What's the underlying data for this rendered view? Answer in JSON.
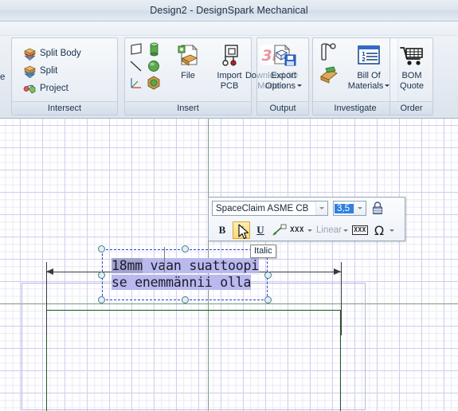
{
  "window": {
    "title": "Design2 - DesignSpark Mechanical"
  },
  "ribbon": {
    "clipped_left_fragment": "e",
    "groups": [
      {
        "name": "Intersect",
        "label": "Intersect",
        "items": [
          {
            "label": "Split Body",
            "icon": "split-body-icon"
          },
          {
            "label": "Split",
            "icon": "split-icon"
          },
          {
            "label": "Project",
            "icon": "project-icon"
          }
        ]
      },
      {
        "name": "Insert",
        "label": "Insert",
        "small_icons": [
          {
            "icon": "plane-icon"
          },
          {
            "icon": "cylinder-icon"
          },
          {
            "icon": "line-icon"
          },
          {
            "icon": "sphere-icon"
          },
          {
            "icon": "axis-system-icon"
          },
          {
            "icon": "cube-icon"
          }
        ],
        "items": [
          {
            "label_line1": "File",
            "label_line2": "",
            "icon": "insert-file-icon",
            "dropdown": false
          },
          {
            "label_line1": "Import",
            "label_line2": "PCB",
            "icon": "import-pcb-icon",
            "dropdown": false
          },
          {
            "label_line1": "Download 3D",
            "label_line2": "Models",
            "icon": "download-3d-icon",
            "dropdown": false
          }
        ]
      },
      {
        "name": "Output",
        "label": "Output",
        "items": [
          {
            "label_line1": "Export",
            "label_line2": "Options",
            "icon": "export-options-icon",
            "dropdown": true
          }
        ]
      },
      {
        "name": "Investigate",
        "label": "Investigate",
        "small_icons": [
          {
            "icon": "measure-icon"
          },
          {
            "icon": "mass-properties-icon"
          }
        ],
        "items": [
          {
            "label_line1": "Bill Of",
            "label_line2": "Materials",
            "icon": "bill-of-materials-icon",
            "dropdown": true
          }
        ]
      },
      {
        "name": "Order",
        "label": "Order",
        "items": [
          {
            "label_line1": "BOM",
            "label_line2": "Quote",
            "icon": "bom-quote-icon",
            "dropdown": false
          }
        ]
      }
    ]
  },
  "format_toolbar": {
    "font_family": {
      "value": "SpaceClaim ASME CB",
      "name": "font-family-combo"
    },
    "font_size": {
      "value": "3,5",
      "selected": true,
      "name": "font-size-combo"
    },
    "lock_button_label": "",
    "buttons": [
      {
        "name": "bold-button",
        "glyph": "B",
        "active": false
      },
      {
        "name": "italic-button",
        "glyph": "I",
        "active": true
      },
      {
        "name": "underline-button",
        "glyph": "U",
        "active": false
      },
      {
        "name": "leader-line-button",
        "glyph": "",
        "active": false
      },
      {
        "name": "text-style-button",
        "glyph": "XXX",
        "active": false
      },
      {
        "name": "linear-dimension-combo",
        "glyph": "Linear",
        "active": false
      },
      {
        "name": "boxed-text-button",
        "glyph": "XXX",
        "active": false
      },
      {
        "name": "symbol-button",
        "glyph": "Ω",
        "active": false
      }
    ]
  },
  "tooltip": {
    "text": "Italic"
  },
  "canvas": {
    "text_object": {
      "line1_selected": "18mm",
      "line1_rest": " vaan suattoopi",
      "line2": "se enemmännii olla"
    }
  }
}
